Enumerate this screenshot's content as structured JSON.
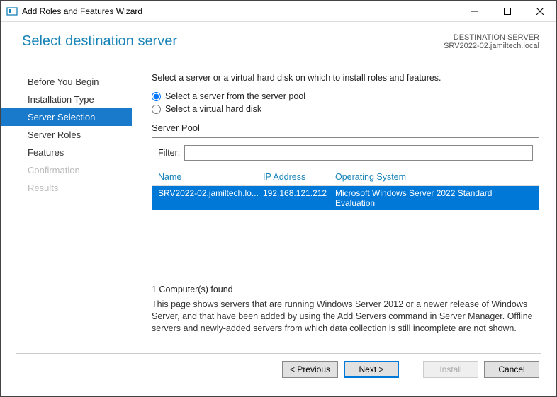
{
  "window": {
    "title": "Add Roles and Features Wizard"
  },
  "header": {
    "title": "Select destination server",
    "meta1": "DESTINATION SERVER",
    "meta2": "SRV2022-02.jamiltech.local"
  },
  "sidebar": {
    "items": [
      {
        "label": "Before You Begin"
      },
      {
        "label": "Installation Type"
      },
      {
        "label": "Server Selection"
      },
      {
        "label": "Server Roles"
      },
      {
        "label": "Features"
      },
      {
        "label": "Confirmation"
      },
      {
        "label": "Results"
      }
    ]
  },
  "main": {
    "instruction": "Select a server or a virtual hard disk on which to install roles and features.",
    "radio1": "Select a server from the server pool",
    "radio2": "Select a virtual hard disk",
    "pool_label": "Server Pool",
    "filter_label": "Filter:",
    "filter_value": "",
    "columns": {
      "name": "Name",
      "ip": "IP Address",
      "os": "Operating System"
    },
    "rows": [
      {
        "name": "SRV2022-02.jamiltech.lo...",
        "ip": "192.168.121.212",
        "os": "Microsoft Windows Server 2022 Standard Evaluation"
      }
    ],
    "found": "1 Computer(s) found",
    "description": "This page shows servers that are running Windows Server 2012 or a newer release of Windows Server, and that have been added by using the Add Servers command in Server Manager. Offline servers and newly-added servers from which data collection is still incomplete are not shown."
  },
  "footer": {
    "previous": "< Previous",
    "next": "Next >",
    "install": "Install",
    "cancel": "Cancel"
  }
}
